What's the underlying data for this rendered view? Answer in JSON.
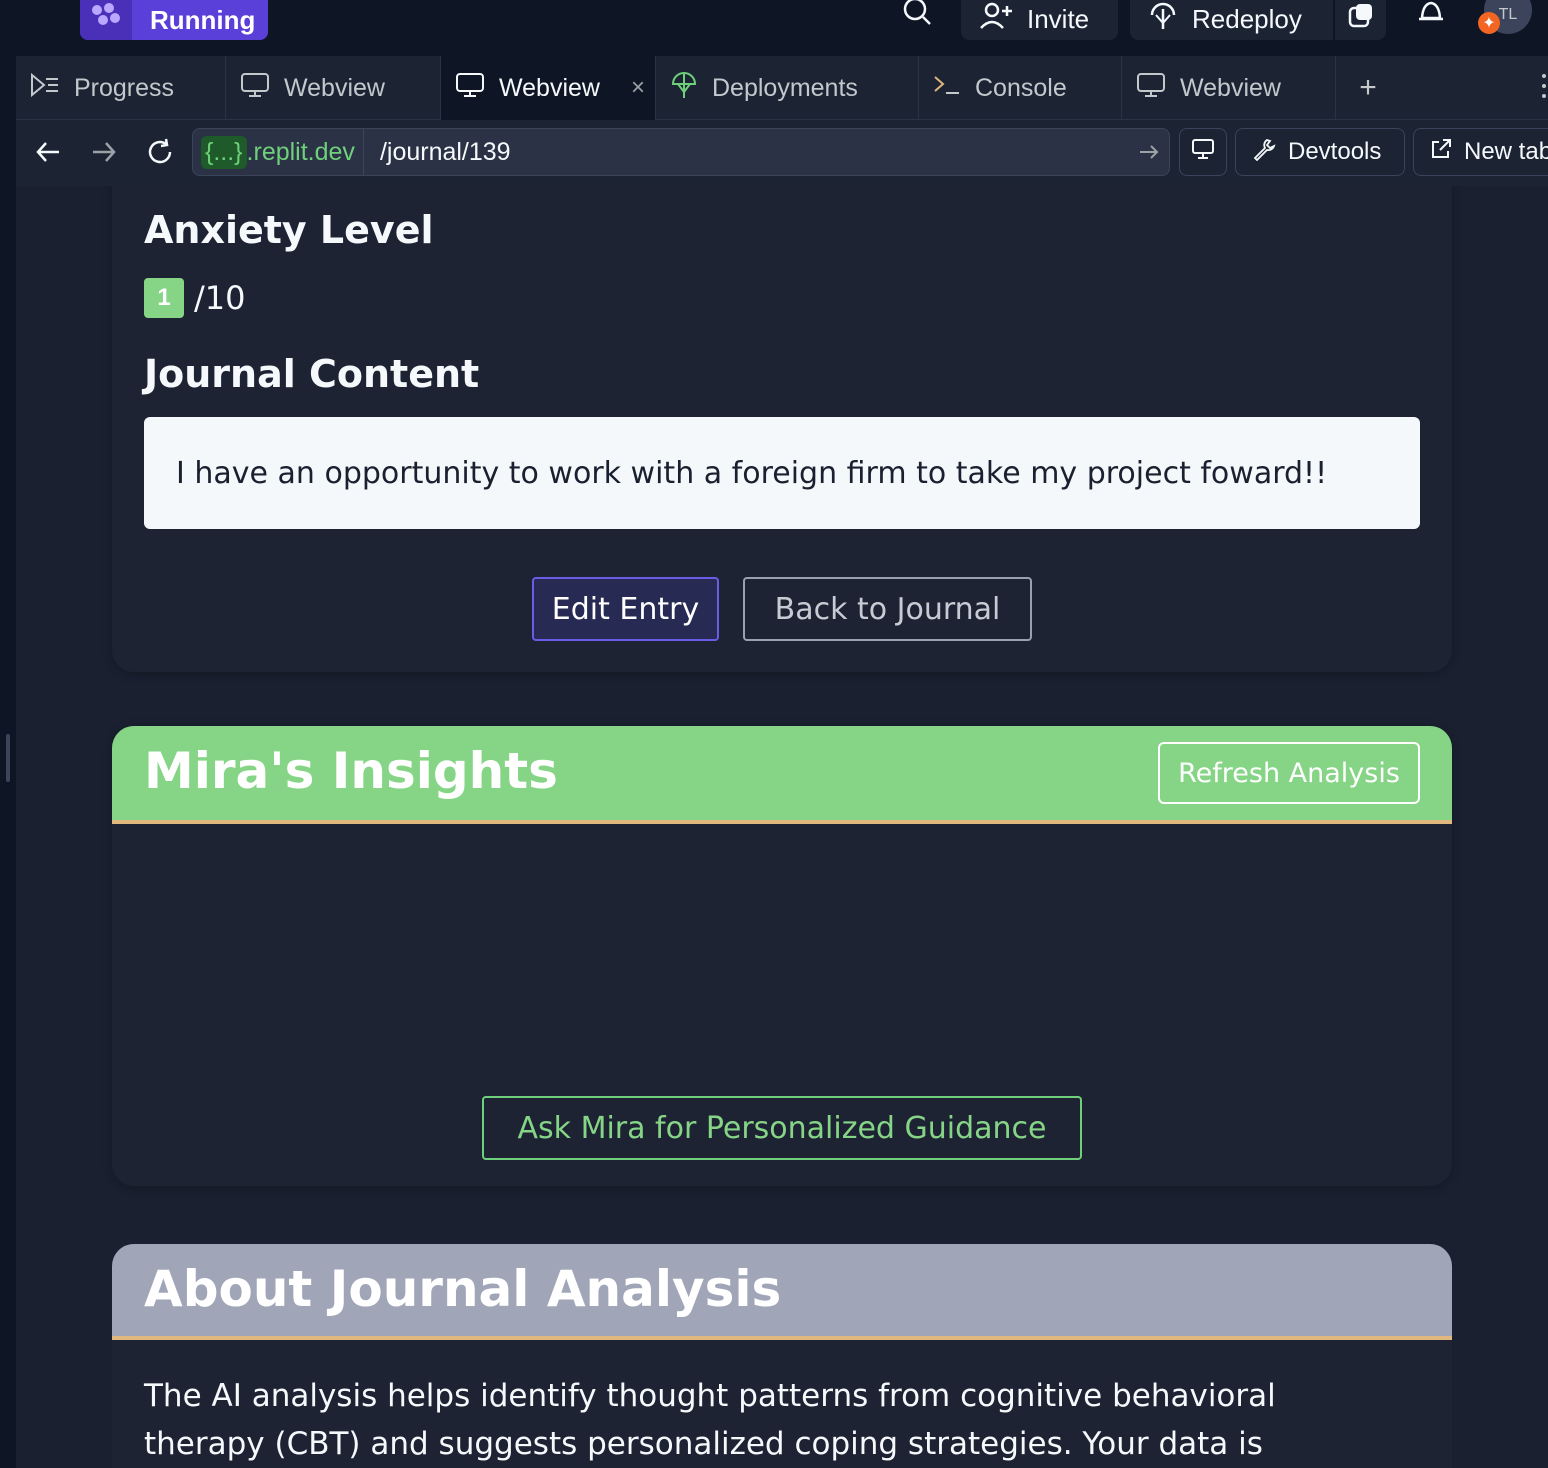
{
  "topbar": {
    "run_label": "Running",
    "invite_label": "Invite",
    "redeploy_label": "Redeploy",
    "avatar_initials": "TL"
  },
  "tabs": [
    {
      "label": "Progress",
      "icon": "progress-icon"
    },
    {
      "label": "Webview",
      "icon": "monitor-icon"
    },
    {
      "label": "Webview",
      "icon": "monitor-icon",
      "active": true
    },
    {
      "label": "Deployments",
      "icon": "deployments-icon"
    },
    {
      "label": "Console",
      "icon": "console-icon"
    },
    {
      "label": "Webview",
      "icon": "monitor-icon"
    }
  ],
  "urlbar": {
    "host_brace": "{...}",
    "host": ".replit.dev",
    "path": "/journal/139",
    "devtools_label": "Devtools",
    "newtab_label": "New tab"
  },
  "entry": {
    "anxiety_heading": "Anxiety Level",
    "anxiety_value": "1",
    "anxiety_max": "/10",
    "content_heading": "Journal Content",
    "content_text": "I have an opportunity to work with a foreign firm to take my project foward!!",
    "edit_label": "Edit Entry",
    "back_label": "Back to Journal"
  },
  "insights": {
    "title": "Mira's Insights",
    "refresh_label": "Refresh Analysis",
    "ask_label": "Ask Mira for Personalized Guidance"
  },
  "about": {
    "title": "About Journal Analysis",
    "body": "The AI analysis helps identify thought patterns from cognitive behavioral therapy (CBT) and suggests personalized coping strategies. Your data is"
  },
  "colors": {
    "accent_purple": "#5a3fd8",
    "insights_green": "#86d586",
    "about_gray": "#a0a6b8",
    "divider_gold": "#e0b77c"
  }
}
